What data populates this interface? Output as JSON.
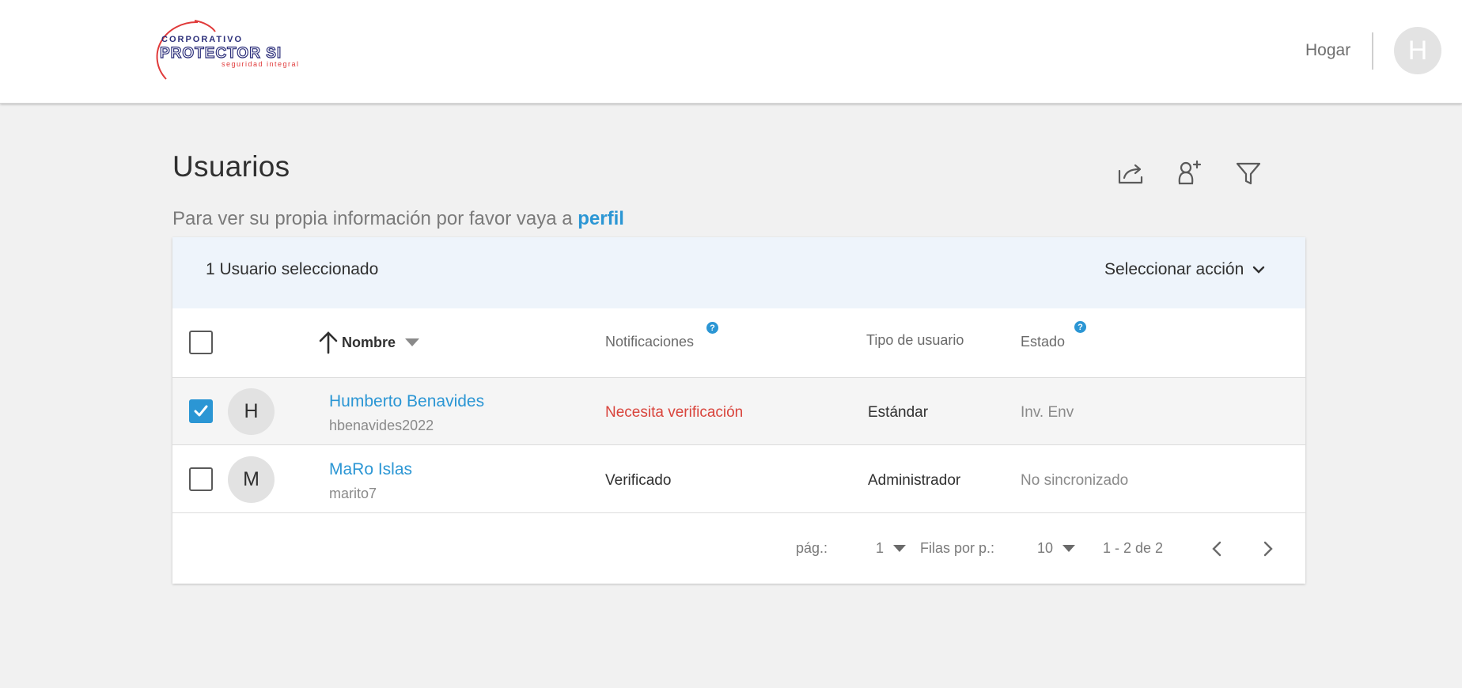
{
  "header": {
    "logo_text": {
      "top": "CORPORATIVO",
      "main": "PROTECTOR SI",
      "tagline": "seguridad integral"
    },
    "home_label": "Hogar",
    "avatar_initial": "H"
  },
  "page": {
    "title": "Usuarios",
    "subtitle_prefix": "Para ver su propia información por favor vaya a",
    "profile_link": "perfil"
  },
  "toolbar": {
    "icons": [
      "export-icon",
      "add-user-icon",
      "filter-icon"
    ]
  },
  "selection": {
    "count_label": "1 Usuario seleccionado",
    "action_label": "Seleccionar acción"
  },
  "table": {
    "columns": {
      "name": "Nombre",
      "notifications": "Notificaciones",
      "user_type": "Tipo de usuario",
      "status": "Estado"
    },
    "help_glyph": "?",
    "rows": [
      {
        "initial": "H",
        "name": "Humberto Benavides",
        "login": "hbenavides2022",
        "notification": "Necesita verificación",
        "user_type": "Estándar",
        "status": "Inv. Env",
        "checked": true
      },
      {
        "initial": "M",
        "name": "MaRo Islas",
        "login": "marito7",
        "notification": "Verificado",
        "user_type": "Administrador",
        "status": "No sincronizado",
        "checked": false
      }
    ]
  },
  "pagination": {
    "page_label": "pág.:",
    "page_value": "1",
    "rows_label": "Filas por p.:",
    "rows_value": "10",
    "range": "1 - 2 de 2"
  },
  "colors": {
    "accent": "#2b96d4",
    "warning": "#d9443c",
    "selection_bar": "#eef4fb",
    "logo_red": "#e03a3a",
    "logo_navy": "#2c2f7a"
  }
}
